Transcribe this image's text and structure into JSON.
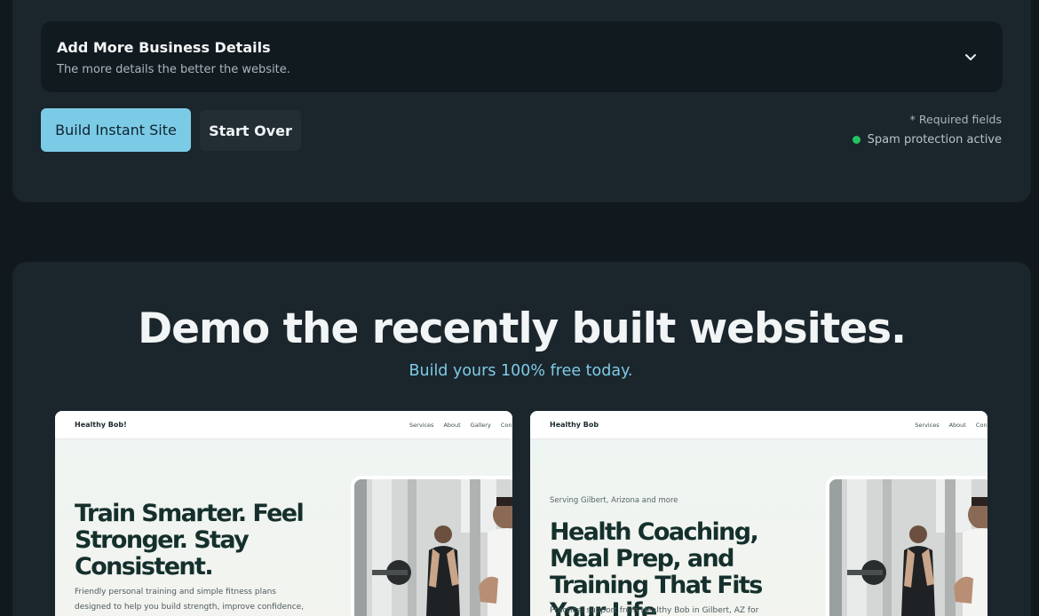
{
  "form": {
    "details_title": "Add More Business Details",
    "details_subtitle": "The more details the better the website.",
    "build_button": "Build Instant Site",
    "start_over_button": "Start Over",
    "required_note": "* Required fields",
    "spam_status": "Spam protection active"
  },
  "demo": {
    "heading": "Demo the recently built websites.",
    "subheading": "Build yours 100% free today.",
    "previews": [
      {
        "brand": "Healthy Bob!",
        "nav": [
          "Services",
          "About",
          "Gallery",
          "Conta"
        ],
        "eyebrow": "",
        "headline": "Train Smarter. Feel Stronger. Stay Consistent.",
        "body": "Friendly personal training and simple fitness plans designed to help you build strength, improve confidence, and keep moving"
      },
      {
        "brand": "Healthy Bob",
        "nav": [
          "Services",
          "About",
          "Conta"
        ],
        "eyebrow": "Serving Gilbert, Arizona and more",
        "headline": "Health Coaching, Meal Prep, and Training That Fits Your Life",
        "body": "Practical support from Healthy Bob in Gilbert, AZ for better habits,"
      }
    ]
  },
  "icons": {
    "details_toggle": "chevron-down-icon",
    "spam_indicator": "status-dot-icon"
  },
  "colors": {
    "accent": "#7ccbe6",
    "status_green": "#23c463",
    "panel": "#1b252c",
    "background": "#12191e"
  }
}
